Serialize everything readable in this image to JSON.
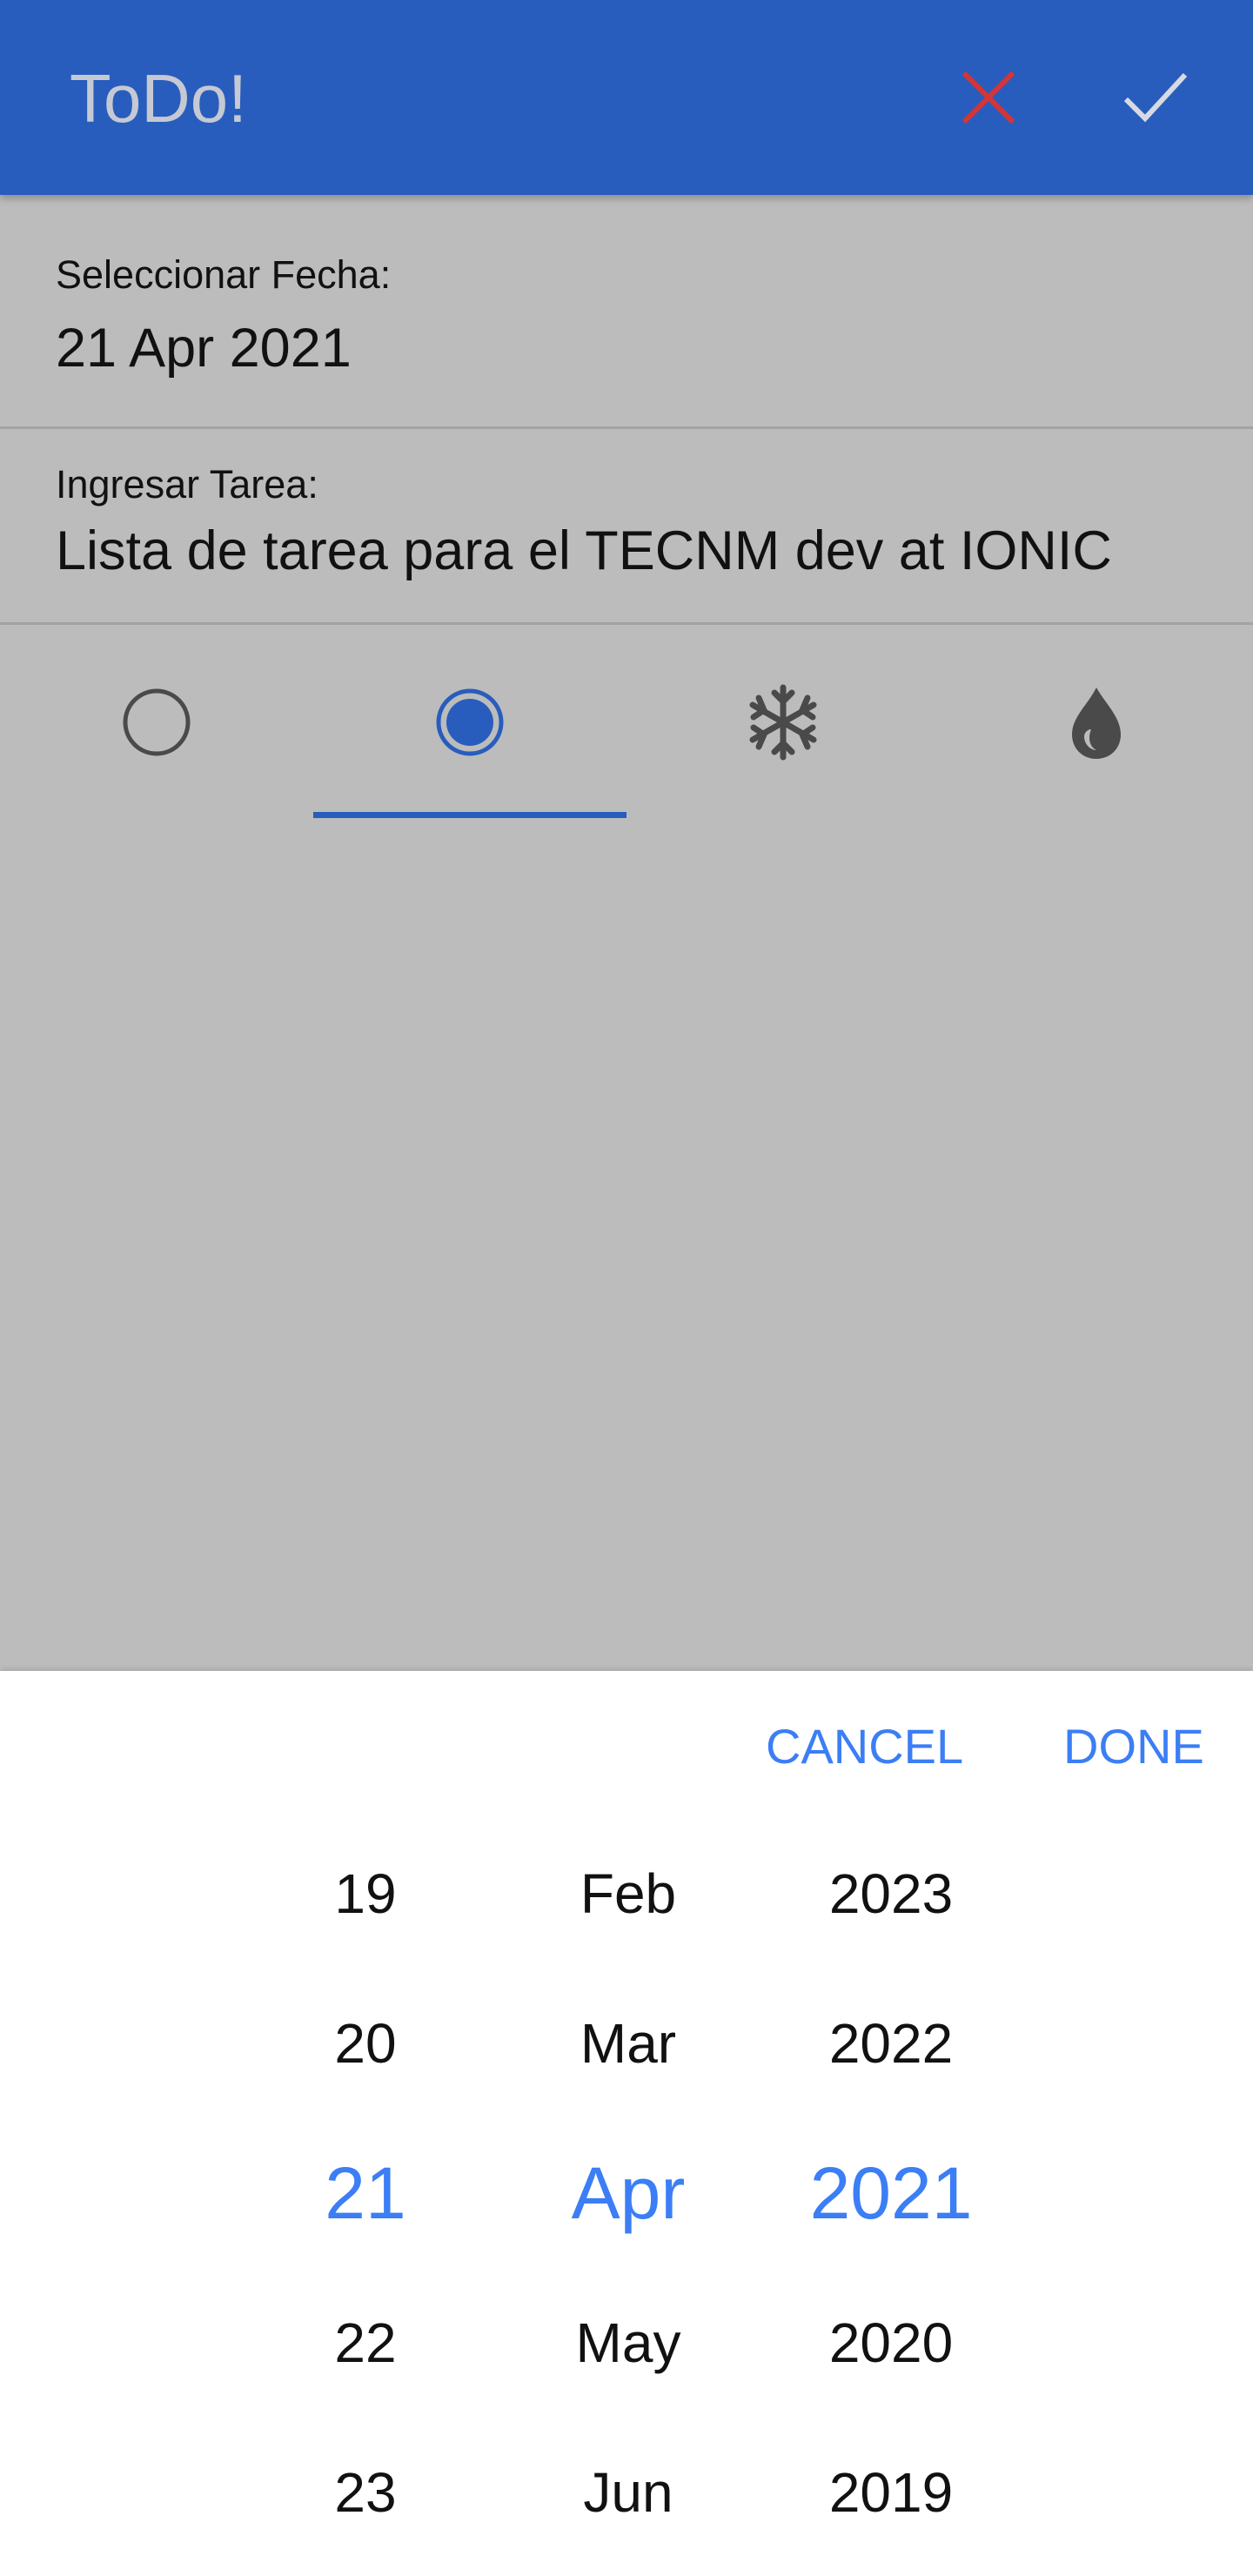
{
  "header": {
    "title": "ToDo!",
    "cancel_icon": "close-icon",
    "confirm_icon": "check-icon",
    "cancel_color": "#d0363a",
    "bg_color": "#285dbd"
  },
  "form": {
    "date_label": "Seleccionar Fecha:",
    "date_value": "21 Apr 2021",
    "task_label": "Ingresar Tarea:",
    "task_value": "Lista de tarea para el TECNM dev at IONIC"
  },
  "segments": {
    "items": [
      {
        "icon": "empty-circle-icon",
        "selected": false
      },
      {
        "icon": "radio-selected-icon",
        "selected": true
      },
      {
        "icon": "snowflake-icon",
        "selected": false
      },
      {
        "icon": "flame-icon",
        "selected": false
      }
    ]
  },
  "picker": {
    "cancel_label": "CANCEL",
    "done_label": "DONE",
    "accent_color": "#3b7ef5",
    "days": [
      "19",
      "20",
      "21",
      "22",
      "23"
    ],
    "months": [
      "Feb",
      "Mar",
      "Apr",
      "May",
      "Jun"
    ],
    "years": [
      "2023",
      "2022",
      "2021",
      "2020",
      "2019"
    ],
    "selected_index": 2
  }
}
